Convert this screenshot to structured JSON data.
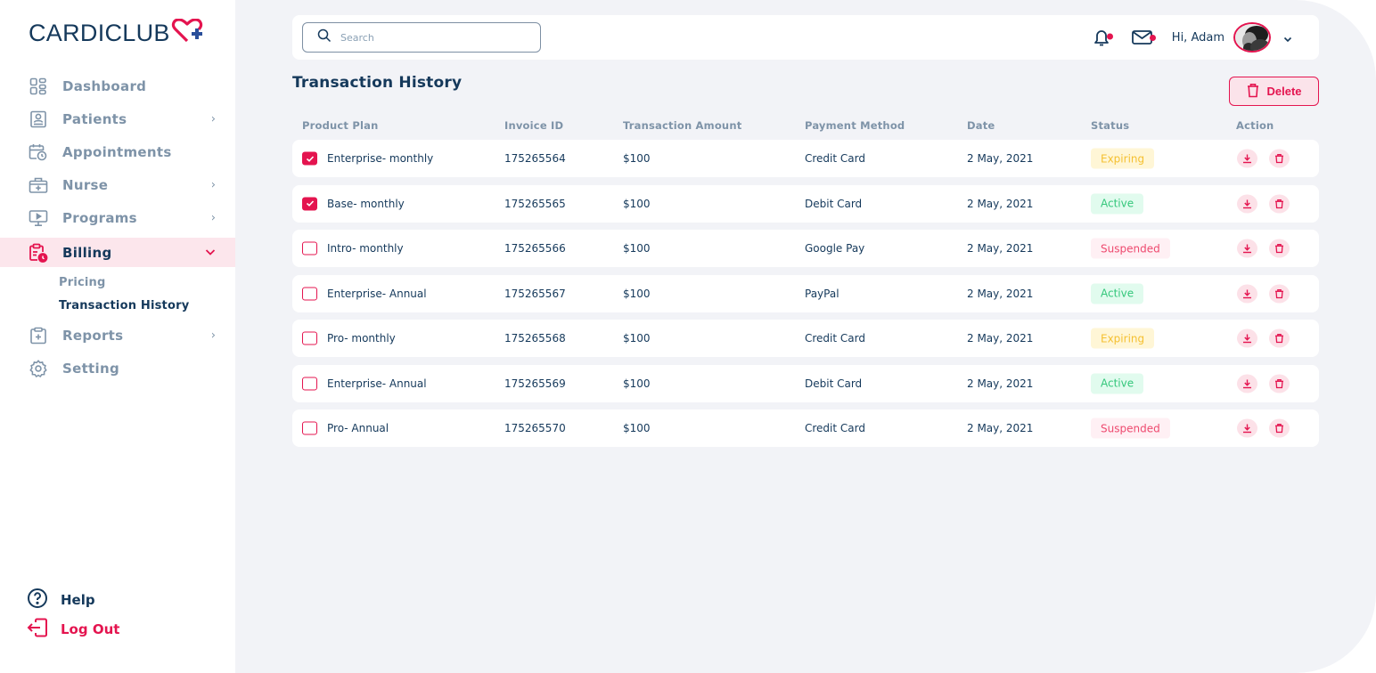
{
  "brand": {
    "name": "CARDICLUB",
    "accent_color": "#e4144f",
    "primary_color": "#15395b"
  },
  "sidebar": {
    "items": [
      {
        "label": "Dashboard",
        "icon": "dashboard-grid-icon",
        "has_chevron": false
      },
      {
        "label": "Patients",
        "icon": "patient-badge-icon",
        "has_chevron": true
      },
      {
        "label": "Appointments",
        "icon": "calendar-clock-icon",
        "has_chevron": false
      },
      {
        "label": "Nurse",
        "icon": "medical-kit-icon",
        "has_chevron": true
      },
      {
        "label": "Programs",
        "icon": "monitor-play-icon",
        "has_chevron": true
      },
      {
        "label": "Billing",
        "icon": "clipboard-clock-icon",
        "has_chevron": true,
        "expanded": true,
        "active": true
      },
      {
        "label": "Reports",
        "icon": "clipboard-plus-icon",
        "has_chevron": true
      },
      {
        "label": "Setting",
        "icon": "gear-icon",
        "has_chevron": false
      }
    ],
    "billing_subitems": [
      {
        "label": "Pricing",
        "current": false
      },
      {
        "label": "Transaction History",
        "current": true
      }
    ],
    "help_label": "Help",
    "logout_label": "Log Out"
  },
  "topbar": {
    "search_placeholder": "Search",
    "search_value": "",
    "notification_badge": true,
    "mail_badge": true,
    "greeting": "Hi, Adam"
  },
  "page": {
    "title": "Transaction History",
    "delete_label": "Delete"
  },
  "table": {
    "columns": [
      "Product Plan",
      "Invoice ID",
      "Transaction Amount",
      "Payment Method",
      "Date",
      "Status",
      "Action"
    ],
    "rows": [
      {
        "checked": true,
        "plan": "Enterprise- monthly",
        "invoice": "175265564",
        "amount": "$100",
        "method": "Credit Card",
        "date": "2 May, 2021",
        "status": "Expiring"
      },
      {
        "checked": true,
        "plan": "Base- monthly",
        "invoice": "175265565",
        "amount": "$100",
        "method": "Debit Card",
        "date": "2 May, 2021",
        "status": "Active"
      },
      {
        "checked": false,
        "plan": "Intro- monthly",
        "invoice": "175265566",
        "amount": "$100",
        "method": "Google Pay",
        "date": "2 May, 2021",
        "status": "Suspended"
      },
      {
        "checked": false,
        "plan": "Enterprise- Annual",
        "invoice": "175265567",
        "amount": "$100",
        "method": "PayPal",
        "date": "2 May, 2021",
        "status": "Active"
      },
      {
        "checked": false,
        "plan": "Pro- monthly",
        "invoice": "175265568",
        "amount": "$100",
        "method": "Credit Card",
        "date": "2 May, 2021",
        "status": "Expiring"
      },
      {
        "checked": false,
        "plan": "Enterprise- Annual",
        "invoice": "175265569",
        "amount": "$100",
        "method": "Debit Card",
        "date": "2 May, 2021",
        "status": "Active"
      },
      {
        "checked": false,
        "plan": "Pro- Annual",
        "invoice": "175265570",
        "amount": "$100",
        "method": "Credit Card",
        "date": "2 May, 2021",
        "status": "Suspended"
      }
    ],
    "status_colors": {
      "Expiring": {
        "text": "#f5c031",
        "bg": "#fff6d6"
      },
      "Active": {
        "text": "#34c77b",
        "bg": "#e1fbee"
      },
      "Suspended": {
        "text": "#ee4a6f",
        "bg": "#fff0f4"
      }
    },
    "action_icons": [
      "download-icon",
      "trash-icon"
    ]
  }
}
